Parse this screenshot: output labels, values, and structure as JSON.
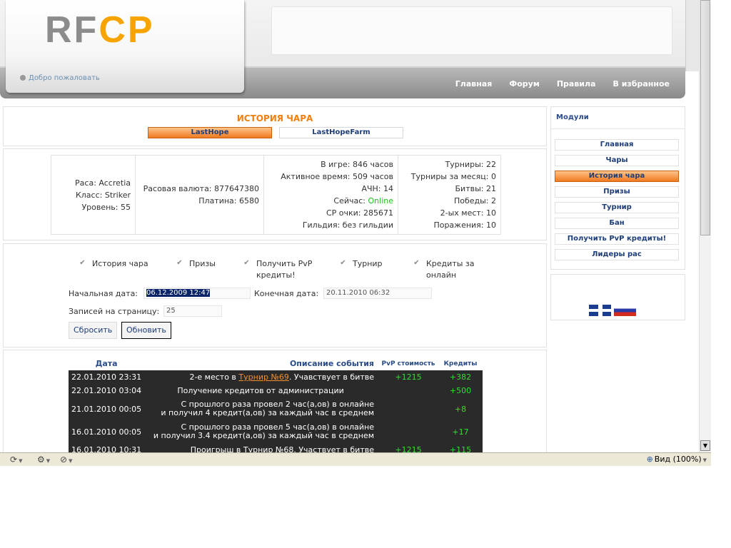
{
  "header": {
    "logo_rf": "RF",
    "logo_cp": "CP",
    "welcome": "Добро пожаловать",
    "nav": [
      "Главная",
      "Форум",
      "Правила",
      "В избранное"
    ]
  },
  "page": {
    "title": "ИСТОРИЯ ЧАРА",
    "char_tabs": [
      "LastHope",
      "LastHopeFarm"
    ]
  },
  "stats": {
    "race": "Раса: Accretia",
    "class": "Класс: Striker",
    "level": "Уровень: 55",
    "race_currency": "Расовая валюта: 877647380",
    "platinum": "Платина: 6580",
    "in_game": "В игре: 846 часов",
    "active_time": "Активное время: 509 часов",
    "ach": "АЧН: 14",
    "now_label": "Сейчас: ",
    "now_value": "Online",
    "cp_points": "CP очки: 285671",
    "guild": "Гильдия: без гильдии",
    "tournaments": "Турниры: 22",
    "tournaments_month": "Турниры за месяц: 0",
    "battles": "Битвы: 21",
    "wins": "Победы: 2",
    "second_places": "2-ых мест: 10",
    "losses": "Поражения: 10"
  },
  "filters": {
    "checkboxes": [
      {
        "label": "История чара"
      },
      {
        "label": "Призы"
      },
      {
        "label": "Получить PvP\nкредиты!"
      },
      {
        "label": "Турнир"
      },
      {
        "label": "Кредиты за\nонлайн"
      }
    ],
    "check_mark": "✔",
    "start_date_label": "Начальная дата:",
    "start_date_value": "06.12.2009 12:47",
    "end_date_label": "Конечная дата:",
    "end_date_value": "20.11.2010 06:32",
    "per_page_label": "Записей на страницу:",
    "per_page_value": "25",
    "reset_button": "Сбросить",
    "update_button": "Обновить"
  },
  "events": {
    "headers": [
      "Дата",
      "Описание события",
      "PvP стоимость",
      "Кредиты"
    ],
    "rows": [
      {
        "date": "22.01.2010 23:31",
        "desc_pre": "2-е место в ",
        "desc_link": "Турнир №69",
        "desc_post": ". Учавствует в битве",
        "pvp": "+1215",
        "credits": "+382"
      },
      {
        "date": "22.01.2010 03:04",
        "desc": "Получение кредитов от администрации",
        "pvp": "",
        "credits": "+500"
      },
      {
        "date": "21.01.2010 00:05",
        "desc_line1": "С прошлого раза провел 2 час(а,ов) в онлайне",
        "desc_line2": "и получил 4 кредит(а,ов) за каждый час в среднем",
        "pvp": "",
        "credits": "+8"
      },
      {
        "date": "16.01.2010 00:05",
        "desc_line1": "С прошлого раза провел 5 час(а,ов) в онлайне",
        "desc_line2": "и получил 3.4 кредит(а,ов) за каждый час в среднем",
        "pvp": "",
        "credits": "+17"
      },
      {
        "date": "16.01.2010 10:31",
        "desc_pre": "Проигрыш в ",
        "desc_link": "Турнир №68",
        "desc_post": ". Участвует в битве",
        "pvp": "+1215",
        "credits": "+115"
      }
    ]
  },
  "sidebar": {
    "modules_title": "Модули",
    "items": [
      "Главная",
      "Чары",
      "История чара",
      "Призы",
      "Турнир",
      "Бан",
      "Получить PvP кредиты!",
      "Лидеры рас"
    ],
    "active_index": 2
  },
  "statusbar": {
    "zoom": "Вид (100%)",
    "icons": [
      "refresh-icon",
      "network-icon",
      "security-zone-icon",
      "zoom-icon"
    ]
  },
  "colors": {
    "accent_orange": "#f07f10",
    "link_blue": "#1d3d78",
    "online_green": "#18c018"
  }
}
